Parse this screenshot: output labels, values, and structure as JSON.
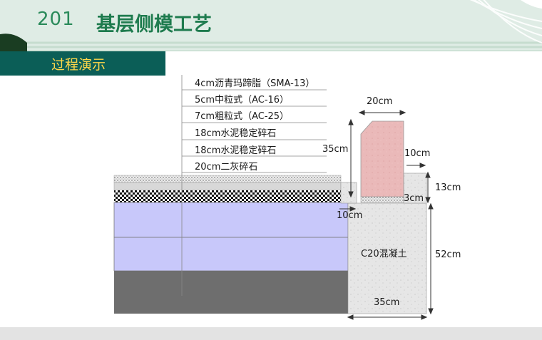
{
  "header": {
    "slide_number": "201",
    "title": "基层侧模工艺",
    "section": "过程演示"
  },
  "diagram": {
    "layers": [
      "4cm沥青玛蹄脂（SMA-13）",
      "5cm中粒式（AC-16）",
      "7cm粗粒式（AC-25）",
      "18cm水泥稳定碎石",
      "18cm水泥稳定碎石",
      "20cm二灰碎石"
    ],
    "dimensions": {
      "curb_width": "20cm",
      "curb_height": "35cm",
      "curb_offset": "10cm",
      "side_height": "13cm",
      "bedding": "3cm",
      "base_offset": "10cm",
      "foundation_depth": "52cm",
      "foundation_width": "35cm"
    },
    "foundation_label": "C20混凝土"
  },
  "colors": {
    "header_bg": "#dfece5",
    "title": "#1e7b4e",
    "banner": "#0b5e57",
    "banner_text": "#ffd84a",
    "cement_layer": "#c8c8fa",
    "lime_layer": "#6e6e6e",
    "curb": "#e9b8b8",
    "concrete": "#e6e6e6"
  }
}
